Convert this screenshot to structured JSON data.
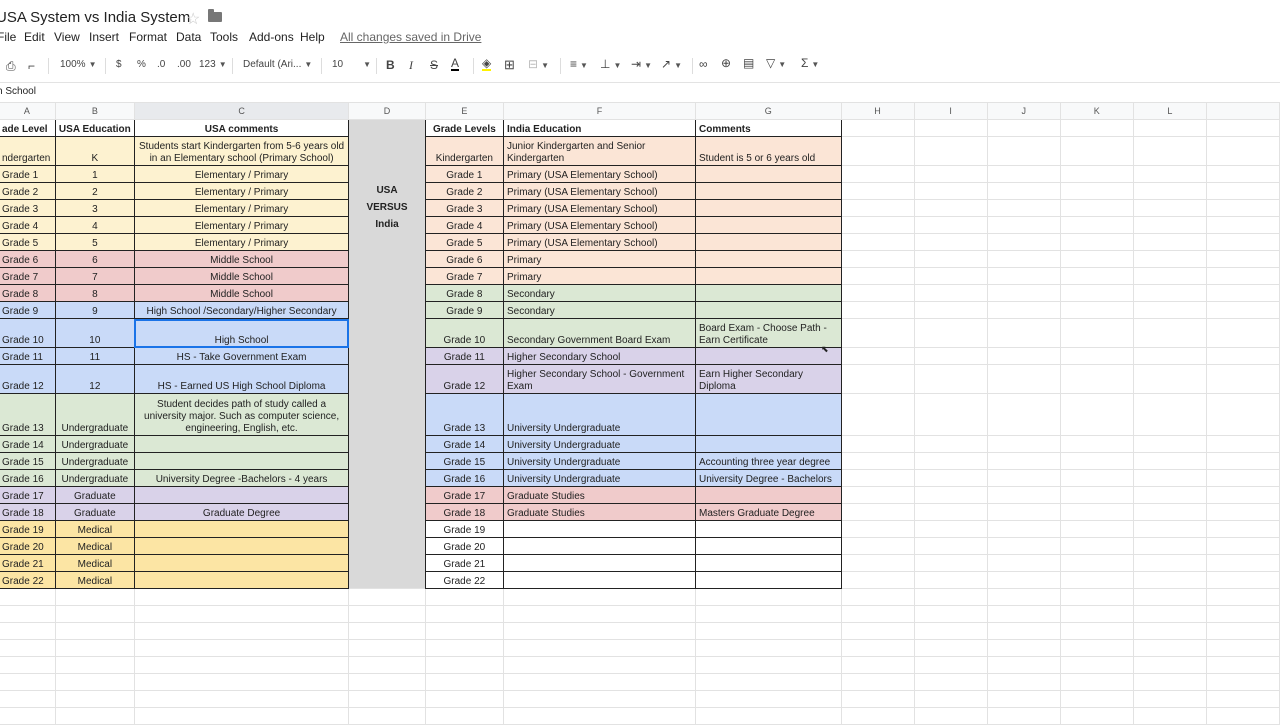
{
  "title": "USA System vs India System",
  "menu": [
    "File",
    "Edit",
    "View",
    "Insert",
    "Format",
    "Data",
    "Tools",
    "Add-ons",
    "Help"
  ],
  "saved_status": "All changes saved in Drive",
  "toolbar": {
    "zoom": "100%",
    "currency": "$",
    "percent": "%",
    "dec_less": ".0",
    "dec_more": ".00",
    "num_format": "123",
    "font": "Default (Ari...",
    "font_size": "10",
    "bold": "B",
    "italic": "I",
    "strike": "S",
    "text_color": "A",
    "sum": "Σ"
  },
  "formula_bar": {
    "value": "h School"
  },
  "columns": [
    "A",
    "B",
    "C",
    "D",
    "E",
    "F",
    "G",
    "H",
    "I",
    "J",
    "K",
    "L",
    ""
  ],
  "colors": {
    "cream": "#fdf2d0",
    "red": "#f0cbcb",
    "blue": "#c9daf8",
    "green": "#dbe8d4",
    "purple": "#d9d2e9",
    "yellow": "#fce5a4",
    "peach": "#fbe5d6",
    "white": "#ffffff",
    "gray": "#d9d9d9"
  },
  "rows": [
    {
      "h": 17,
      "cells": [
        {
          "t": "ade Level",
          "k": "l b bd"
        },
        {
          "t": "USA Education",
          "k": "c b bd"
        },
        {
          "t": "USA comments",
          "k": "c b bd"
        },
        {
          "t": "",
          "k": "D"
        },
        {
          "t": "Grade Levels",
          "k": "c b bd"
        },
        {
          "t": "India Education",
          "k": "l b bd"
        },
        {
          "t": "Comments",
          "k": "l b bd"
        }
      ]
    },
    {
      "h": 29,
      "cells": [
        {
          "t": "ndergarten",
          "k": "l bd",
          "bg": "cream"
        },
        {
          "t": "K",
          "k": "c bd",
          "bg": "cream"
        },
        {
          "t": "Students start Kindergarten from  5-6 years old in an Elementary school (Primary School)",
          "k": "c bd wrap",
          "bg": "cream"
        },
        {
          "t": "",
          "k": "D"
        },
        {
          "t": "Kindergarten",
          "k": "c bd",
          "bg": "peach"
        },
        {
          "t": "Junior Kindergarten and Senior Kindergarten",
          "k": "l bd wrap",
          "bg": "peach"
        },
        {
          "t": "Student is 5 or 6 years old",
          "k": "l bd",
          "bg": "peach"
        }
      ]
    },
    {
      "h": 17,
      "cells": [
        {
          "t": "Grade 1",
          "k": "l bd",
          "bg": "cream"
        },
        {
          "t": "1",
          "k": "c bd",
          "bg": "cream"
        },
        {
          "t": "Elementary / Primary",
          "k": "c bd",
          "bg": "cream"
        },
        {
          "t": "",
          "k": "D"
        },
        {
          "t": "Grade 1",
          "k": "c bd",
          "bg": "peach"
        },
        {
          "t": "Primary (USA Elementary School)",
          "k": "l bd",
          "bg": "peach"
        },
        {
          "t": "",
          "k": "l bd",
          "bg": "peach"
        }
      ]
    },
    {
      "h": 17,
      "cells": [
        {
          "t": "Grade 2",
          "k": "l bd",
          "bg": "cream"
        },
        {
          "t": "2",
          "k": "c bd",
          "bg": "cream"
        },
        {
          "t": "Elementary / Primary",
          "k": "c bd",
          "bg": "cream"
        },
        {
          "t": "USA",
          "k": "D"
        },
        {
          "t": "Grade 2",
          "k": "c bd",
          "bg": "peach"
        },
        {
          "t": "Primary (USA Elementary School)",
          "k": "l bd",
          "bg": "peach"
        },
        {
          "t": "",
          "k": "l bd",
          "bg": "peach"
        }
      ]
    },
    {
      "h": 17,
      "cells": [
        {
          "t": "Grade 3",
          "k": "l bd",
          "bg": "cream"
        },
        {
          "t": "3",
          "k": "c bd",
          "bg": "cream"
        },
        {
          "t": "Elementary / Primary",
          "k": "c bd",
          "bg": "cream"
        },
        {
          "t": "VERSUS",
          "k": "D"
        },
        {
          "t": "Grade 3",
          "k": "c bd",
          "bg": "peach"
        },
        {
          "t": "Primary (USA Elementary School)",
          "k": "l bd",
          "bg": "peach"
        },
        {
          "t": "",
          "k": "l bd",
          "bg": "peach"
        }
      ]
    },
    {
      "h": 17,
      "cells": [
        {
          "t": "Grade 4",
          "k": "l bd",
          "bg": "cream"
        },
        {
          "t": "4",
          "k": "c bd",
          "bg": "cream"
        },
        {
          "t": "Elementary / Primary",
          "k": "c bd",
          "bg": "cream"
        },
        {
          "t": "India",
          "k": "D"
        },
        {
          "t": "Grade 4",
          "k": "c bd",
          "bg": "peach"
        },
        {
          "t": "Primary (USA Elementary School)",
          "k": "l bd",
          "bg": "peach"
        },
        {
          "t": "",
          "k": "l bd",
          "bg": "peach"
        }
      ]
    },
    {
      "h": 17,
      "cells": [
        {
          "t": "Grade 5",
          "k": "l bd",
          "bg": "cream"
        },
        {
          "t": "5",
          "k": "c bd",
          "bg": "cream"
        },
        {
          "t": "Elementary / Primary",
          "k": "c bd",
          "bg": "cream"
        },
        {
          "t": "",
          "k": "D"
        },
        {
          "t": "Grade 5",
          "k": "c bd",
          "bg": "peach"
        },
        {
          "t": "Primary (USA Elementary School)",
          "k": "l bd",
          "bg": "peach"
        },
        {
          "t": "",
          "k": "l bd",
          "bg": "peach"
        }
      ]
    },
    {
      "h": 17,
      "cells": [
        {
          "t": "Grade 6",
          "k": "l bd",
          "bg": "red"
        },
        {
          "t": "6",
          "k": "c bd",
          "bg": "red"
        },
        {
          "t": "Middle School",
          "k": "c bd",
          "bg": "red"
        },
        {
          "t": "",
          "k": "D"
        },
        {
          "t": "Grade 6",
          "k": "c bd",
          "bg": "peach"
        },
        {
          "t": "Primary",
          "k": "l bd",
          "bg": "peach"
        },
        {
          "t": "",
          "k": "l bd",
          "bg": "peach"
        }
      ]
    },
    {
      "h": 17,
      "cells": [
        {
          "t": "Grade 7",
          "k": "l bd",
          "bg": "red"
        },
        {
          "t": "7",
          "k": "c bd",
          "bg": "red"
        },
        {
          "t": "Middle School",
          "k": "c bd",
          "bg": "red"
        },
        {
          "t": "",
          "k": "D"
        },
        {
          "t": "Grade 7",
          "k": "c bd",
          "bg": "peach"
        },
        {
          "t": "Primary",
          "k": "l bd",
          "bg": "peach"
        },
        {
          "t": "",
          "k": "l bd",
          "bg": "peach"
        }
      ]
    },
    {
      "h": 17,
      "cells": [
        {
          "t": "Grade 8",
          "k": "l bd",
          "bg": "red"
        },
        {
          "t": "8",
          "k": "c bd",
          "bg": "red"
        },
        {
          "t": "Middle School",
          "k": "c bd",
          "bg": "red"
        },
        {
          "t": "",
          "k": "D"
        },
        {
          "t": "Grade 8",
          "k": "c bd",
          "bg": "green"
        },
        {
          "t": "Secondary",
          "k": "l bd",
          "bg": "green"
        },
        {
          "t": "",
          "k": "l bd",
          "bg": "green"
        }
      ]
    },
    {
      "h": 17,
      "cells": [
        {
          "t": "Grade 9",
          "k": "l bd",
          "bg": "blue"
        },
        {
          "t": "9",
          "k": "c bd",
          "bg": "blue"
        },
        {
          "t": "High School /Secondary/Higher Secondary",
          "k": "c bd",
          "bg": "blue"
        },
        {
          "t": "",
          "k": "D"
        },
        {
          "t": "Grade 9",
          "k": "c bd",
          "bg": "green"
        },
        {
          "t": "Secondary",
          "k": "l bd",
          "bg": "green"
        },
        {
          "t": "",
          "k": "l bd",
          "bg": "green"
        }
      ]
    },
    {
      "h": 29,
      "cells": [
        {
          "t": "Grade 10",
          "k": "l bd",
          "bg": "blue"
        },
        {
          "t": "10",
          "k": "c bd",
          "bg": "blue"
        },
        {
          "t": "High School",
          "k": "c bd sel",
          "bg": "blue"
        },
        {
          "t": "",
          "k": "D"
        },
        {
          "t": "Grade 10",
          "k": "c bd",
          "bg": "green"
        },
        {
          "t": "Secondary Government Board Exam",
          "k": "l bd",
          "bg": "green"
        },
        {
          "t": "Board Exam - Choose Path - Earn Certificate",
          "k": "l bd wrap",
          "bg": "green"
        }
      ]
    },
    {
      "h": 17,
      "cells": [
        {
          "t": "Grade 11",
          "k": "l bd",
          "bg": "blue"
        },
        {
          "t": "11",
          "k": "c bd",
          "bg": "blue"
        },
        {
          "t": "HS - Take Government Exam",
          "k": "c bd",
          "bg": "blue"
        },
        {
          "t": "",
          "k": "D"
        },
        {
          "t": "Grade 11",
          "k": "c bd",
          "bg": "purple"
        },
        {
          "t": "Higher Secondary School",
          "k": "l bd",
          "bg": "purple"
        },
        {
          "t": "",
          "k": "l bd",
          "bg": "purple"
        }
      ]
    },
    {
      "h": 29,
      "cells": [
        {
          "t": "Grade 12",
          "k": "l bd",
          "bg": "blue"
        },
        {
          "t": "12",
          "k": "c bd",
          "bg": "blue"
        },
        {
          "t": "HS - Earned US High School Diploma",
          "k": "c bd",
          "bg": "blue"
        },
        {
          "t": "",
          "k": "D"
        },
        {
          "t": "Grade 12",
          "k": "c bd",
          "bg": "purple"
        },
        {
          "t": "Higher Secondary  School - Government Exam",
          "k": "l bd wrap",
          "bg": "purple"
        },
        {
          "t": "Earn Higher Secondary Diploma",
          "k": "l bd wrap",
          "bg": "purple"
        }
      ]
    },
    {
      "h": 42,
      "cells": [
        {
          "t": "Grade 13",
          "k": "l bd",
          "bg": "green"
        },
        {
          "t": "Undergraduate",
          "k": "c bd",
          "bg": "green"
        },
        {
          "t": "Student decides path of study called a university major. Such as computer science, engineering, English, etc.",
          "k": "c bd wrap",
          "bg": "green"
        },
        {
          "t": "",
          "k": "D"
        },
        {
          "t": "Grade 13",
          "k": "c bd",
          "bg": "blue"
        },
        {
          "t": "University Undergraduate",
          "k": "l bd",
          "bg": "blue"
        },
        {
          "t": "",
          "k": "l bd",
          "bg": "blue"
        }
      ]
    },
    {
      "h": 17,
      "cells": [
        {
          "t": "Grade 14",
          "k": "l bd",
          "bg": "green"
        },
        {
          "t": "Undergraduate",
          "k": "c bd",
          "bg": "green"
        },
        {
          "t": "",
          "k": "c bd",
          "bg": "green"
        },
        {
          "t": "",
          "k": "D"
        },
        {
          "t": "Grade 14",
          "k": "c bd",
          "bg": "blue"
        },
        {
          "t": "University Undergraduate",
          "k": "l bd",
          "bg": "blue"
        },
        {
          "t": "",
          "k": "l bd",
          "bg": "blue"
        }
      ]
    },
    {
      "h": 17,
      "cells": [
        {
          "t": "Grade 15",
          "k": "l bd",
          "bg": "green"
        },
        {
          "t": "Undergraduate",
          "k": "c bd",
          "bg": "green"
        },
        {
          "t": "",
          "k": "c bd",
          "bg": "green"
        },
        {
          "t": "",
          "k": "D"
        },
        {
          "t": "Grade 15",
          "k": "c bd",
          "bg": "blue"
        },
        {
          "t": "University Undergraduate",
          "k": "l bd",
          "bg": "blue"
        },
        {
          "t": "Accounting three year degree",
          "k": "l bd",
          "bg": "blue"
        }
      ]
    },
    {
      "h": 17,
      "cells": [
        {
          "t": "Grade 16",
          "k": "l bd",
          "bg": "green"
        },
        {
          "t": "Undergraduate",
          "k": "c bd",
          "bg": "green"
        },
        {
          "t": "University Degree -Bachelors - 4 years",
          "k": "c bd",
          "bg": "green"
        },
        {
          "t": "",
          "k": "D"
        },
        {
          "t": "Grade 16",
          "k": "c bd",
          "bg": "blue"
        },
        {
          "t": "University Undergraduate",
          "k": "l bd",
          "bg": "blue"
        },
        {
          "t": "University Degree - Bachelors",
          "k": "l bd",
          "bg": "blue"
        }
      ]
    },
    {
      "h": 17,
      "cells": [
        {
          "t": "Grade 17",
          "k": "l bd",
          "bg": "purple"
        },
        {
          "t": "Graduate",
          "k": "c bd",
          "bg": "purple"
        },
        {
          "t": "",
          "k": "c bd",
          "bg": "purple"
        },
        {
          "t": "",
          "k": "D"
        },
        {
          "t": "Grade 17",
          "k": "c bd",
          "bg": "red"
        },
        {
          "t": "Graduate Studies",
          "k": "l bd",
          "bg": "red"
        },
        {
          "t": "",
          "k": "l bd",
          "bg": "red"
        }
      ]
    },
    {
      "h": 17,
      "cells": [
        {
          "t": "Grade 18",
          "k": "l bd",
          "bg": "purple"
        },
        {
          "t": "Graduate",
          "k": "c bd",
          "bg": "purple"
        },
        {
          "t": "Graduate Degree",
          "k": "c bd",
          "bg": "purple"
        },
        {
          "t": "",
          "k": "D"
        },
        {
          "t": "Grade 18",
          "k": "c bd",
          "bg": "red"
        },
        {
          "t": "Graduate Studies",
          "k": "l bd",
          "bg": "red"
        },
        {
          "t": "Masters Graduate Degree",
          "k": "l bd",
          "bg": "red"
        }
      ]
    },
    {
      "h": 17,
      "cells": [
        {
          "t": "Grade 19",
          "k": "l bd",
          "bg": "yellow"
        },
        {
          "t": "Medical",
          "k": "c bd",
          "bg": "yellow"
        },
        {
          "t": "",
          "k": "c bd",
          "bg": "yellow"
        },
        {
          "t": "",
          "k": "D"
        },
        {
          "t": "Grade 19",
          "k": "c bd",
          "bg": "white"
        },
        {
          "t": "",
          "k": "l bd",
          "bg": "white"
        },
        {
          "t": "",
          "k": "l bd",
          "bg": "white"
        }
      ]
    },
    {
      "h": 17,
      "cells": [
        {
          "t": "Grade 20",
          "k": "l bd",
          "bg": "yellow"
        },
        {
          "t": "Medical",
          "k": "c bd",
          "bg": "yellow"
        },
        {
          "t": "",
          "k": "c bd",
          "bg": "yellow"
        },
        {
          "t": "",
          "k": "D"
        },
        {
          "t": "Grade 20",
          "k": "c bd",
          "bg": "white"
        },
        {
          "t": "",
          "k": "l bd",
          "bg": "white"
        },
        {
          "t": "",
          "k": "l bd",
          "bg": "white"
        }
      ]
    },
    {
      "h": 17,
      "cells": [
        {
          "t": "Grade 21",
          "k": "l bd",
          "bg": "yellow"
        },
        {
          "t": "Medical",
          "k": "c bd",
          "bg": "yellow"
        },
        {
          "t": "",
          "k": "c bd",
          "bg": "yellow"
        },
        {
          "t": "",
          "k": "D"
        },
        {
          "t": "Grade 21",
          "k": "c bd",
          "bg": "white"
        },
        {
          "t": "",
          "k": "l bd",
          "bg": "white"
        },
        {
          "t": "",
          "k": "l bd",
          "bg": "white"
        }
      ]
    },
    {
      "h": 17,
      "cells": [
        {
          "t": "Grade 22",
          "k": "l bd",
          "bg": "yellow"
        },
        {
          "t": "Medical",
          "k": "c bd",
          "bg": "yellow"
        },
        {
          "t": "",
          "k": "c bd",
          "bg": "yellow"
        },
        {
          "t": "",
          "k": "D"
        },
        {
          "t": "Grade 22",
          "k": "c bd",
          "bg": "white"
        },
        {
          "t": "",
          "k": "l bd",
          "bg": "white"
        },
        {
          "t": "",
          "k": "l bd",
          "bg": "white"
        }
      ]
    }
  ],
  "empty_rows": 8
}
